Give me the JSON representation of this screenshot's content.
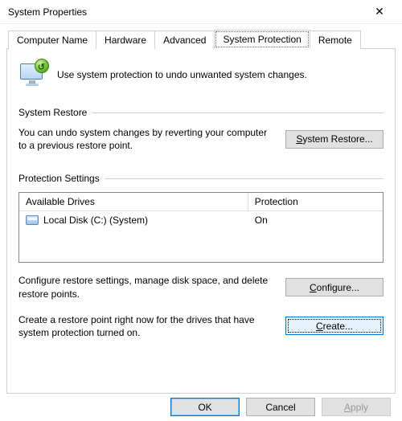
{
  "window": {
    "title": "System Properties",
    "close_glyph": "✕"
  },
  "tabs": {
    "computer_name": "Computer Name",
    "hardware": "Hardware",
    "advanced": "Advanced",
    "system_protection": "System Protection",
    "remote": "Remote"
  },
  "intro": "Use system protection to undo unwanted system changes.",
  "system_restore": {
    "header": "System Restore",
    "text": "You can undo system changes by reverting your computer to a previous restore point.",
    "button_prefix": "S",
    "button_rest": "ystem Restore..."
  },
  "protection_settings": {
    "header": "Protection Settings",
    "col_drives": "Available Drives",
    "col_protection": "Protection",
    "drive_name": "Local Disk (C:) (System)",
    "drive_status": "On",
    "configure_text": "Configure restore settings, manage disk space, and delete restore points.",
    "configure_btn_prefix": "C",
    "configure_btn_rest": "onfigure...",
    "create_text": "Create a restore point right now for the drives that have system protection turned on.",
    "create_btn_prefix": "C",
    "create_btn_rest": "reate..."
  },
  "footer": {
    "ok": "OK",
    "cancel": "Cancel",
    "apply_prefix": "A",
    "apply_rest": "pply"
  },
  "annotation": {
    "arrow_color": "#f03a2d",
    "highlight_color": "#f03a2d"
  }
}
